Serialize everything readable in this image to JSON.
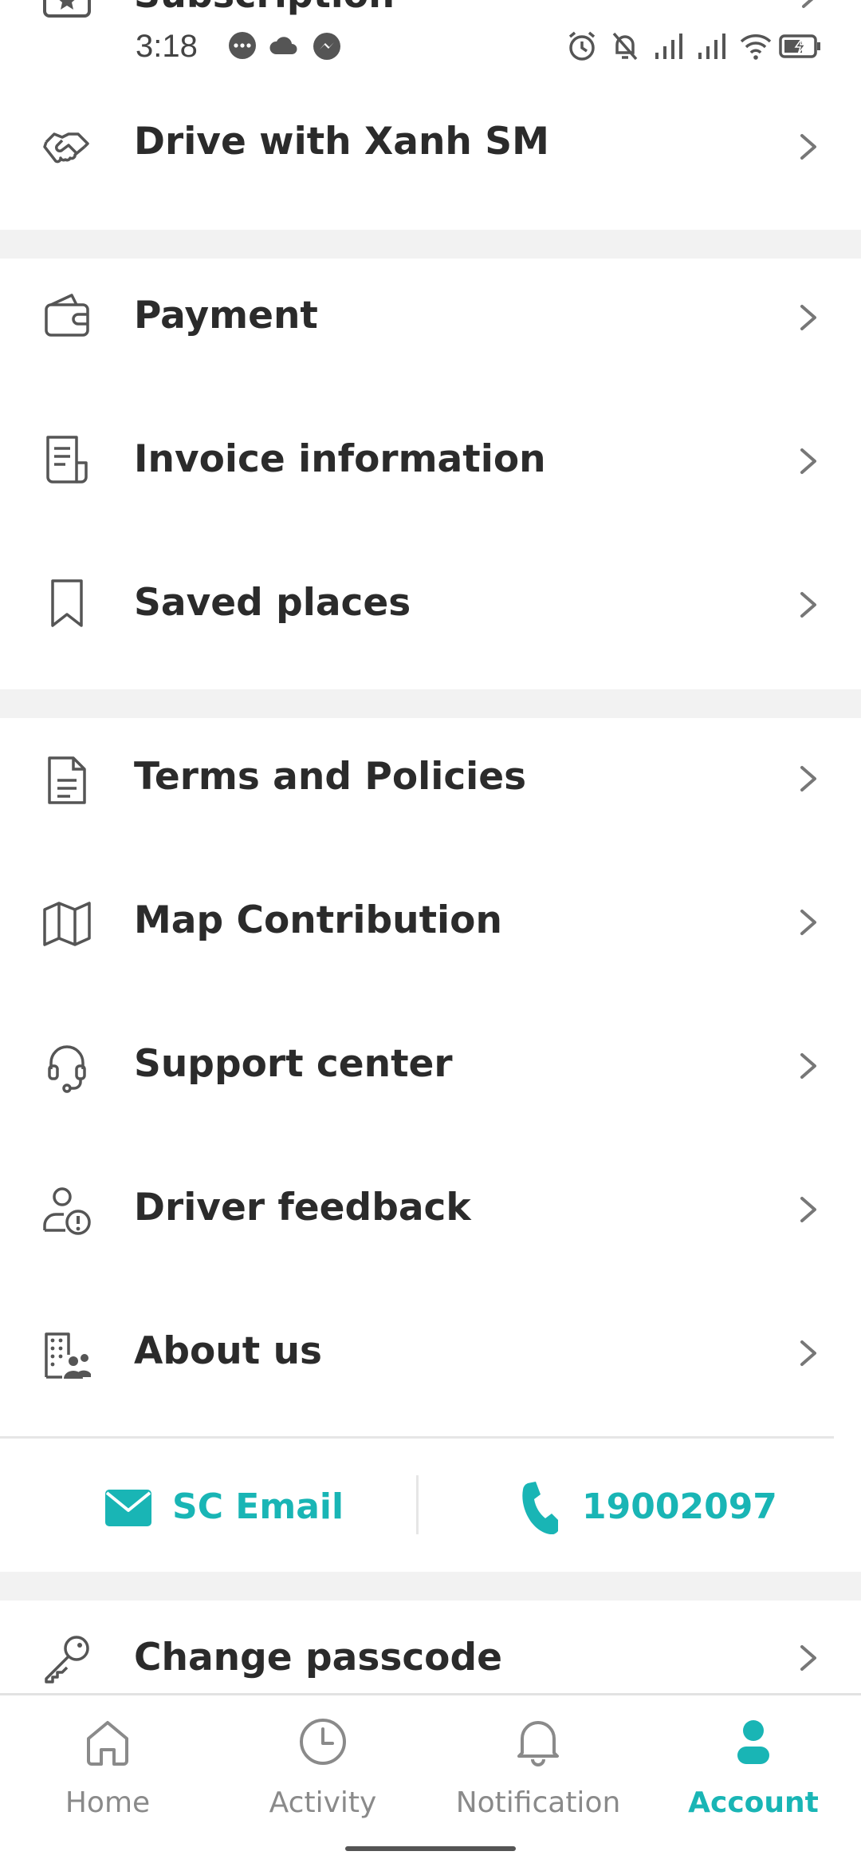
{
  "status_bar": {
    "time": "3:18"
  },
  "peek_row": {
    "label": "Subscription"
  },
  "menu": {
    "drive": {
      "label": "Drive with Xanh SM",
      "icon": "handshake-icon"
    },
    "payment": {
      "label": "Payment",
      "icon": "wallet-icon"
    },
    "invoice": {
      "label": "Invoice information",
      "icon": "invoice-icon"
    },
    "saved_places": {
      "label": "Saved places",
      "icon": "bookmark-icon"
    },
    "terms": {
      "label": "Terms and Policies",
      "icon": "document-icon"
    },
    "map_contribution": {
      "label": "Map Contribution",
      "icon": "map-icon"
    },
    "support": {
      "label": "Support center",
      "icon": "headset-icon"
    },
    "driver_feedback": {
      "label": "Driver feedback",
      "icon": "user-alert-icon"
    },
    "about": {
      "label": "About us",
      "icon": "building-icon"
    },
    "change_passcode": {
      "label": "Change passcode",
      "icon": "key-icon"
    }
  },
  "contact": {
    "email_label": "SC Email",
    "phone_label": "19002097"
  },
  "bottom_nav": {
    "home": "Home",
    "activity": "Activity",
    "notification": "Notification",
    "account": "Account"
  },
  "colors": {
    "accent": "#19b5b5",
    "text": "#2b2b2b",
    "section_gap": "#f2f2f2",
    "inactive_nav": "#8a8a8a"
  }
}
